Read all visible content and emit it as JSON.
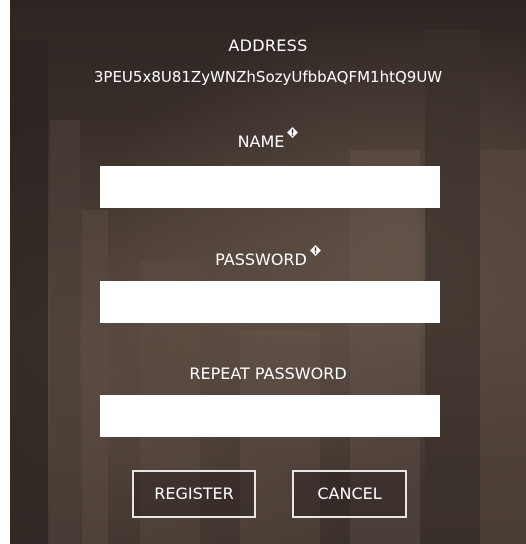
{
  "address": {
    "title": "ADDRESS",
    "value": "3PEU5x8U81ZyWNZhSozyUfbbAQFM1htQ9UW"
  },
  "fields": {
    "name_label": "NAME",
    "password_label": "PASSWORD",
    "repeat_password_label": "REPEAT PASSWORD"
  },
  "buttons": {
    "register": "REGISTER",
    "cancel": "CANCEL"
  }
}
